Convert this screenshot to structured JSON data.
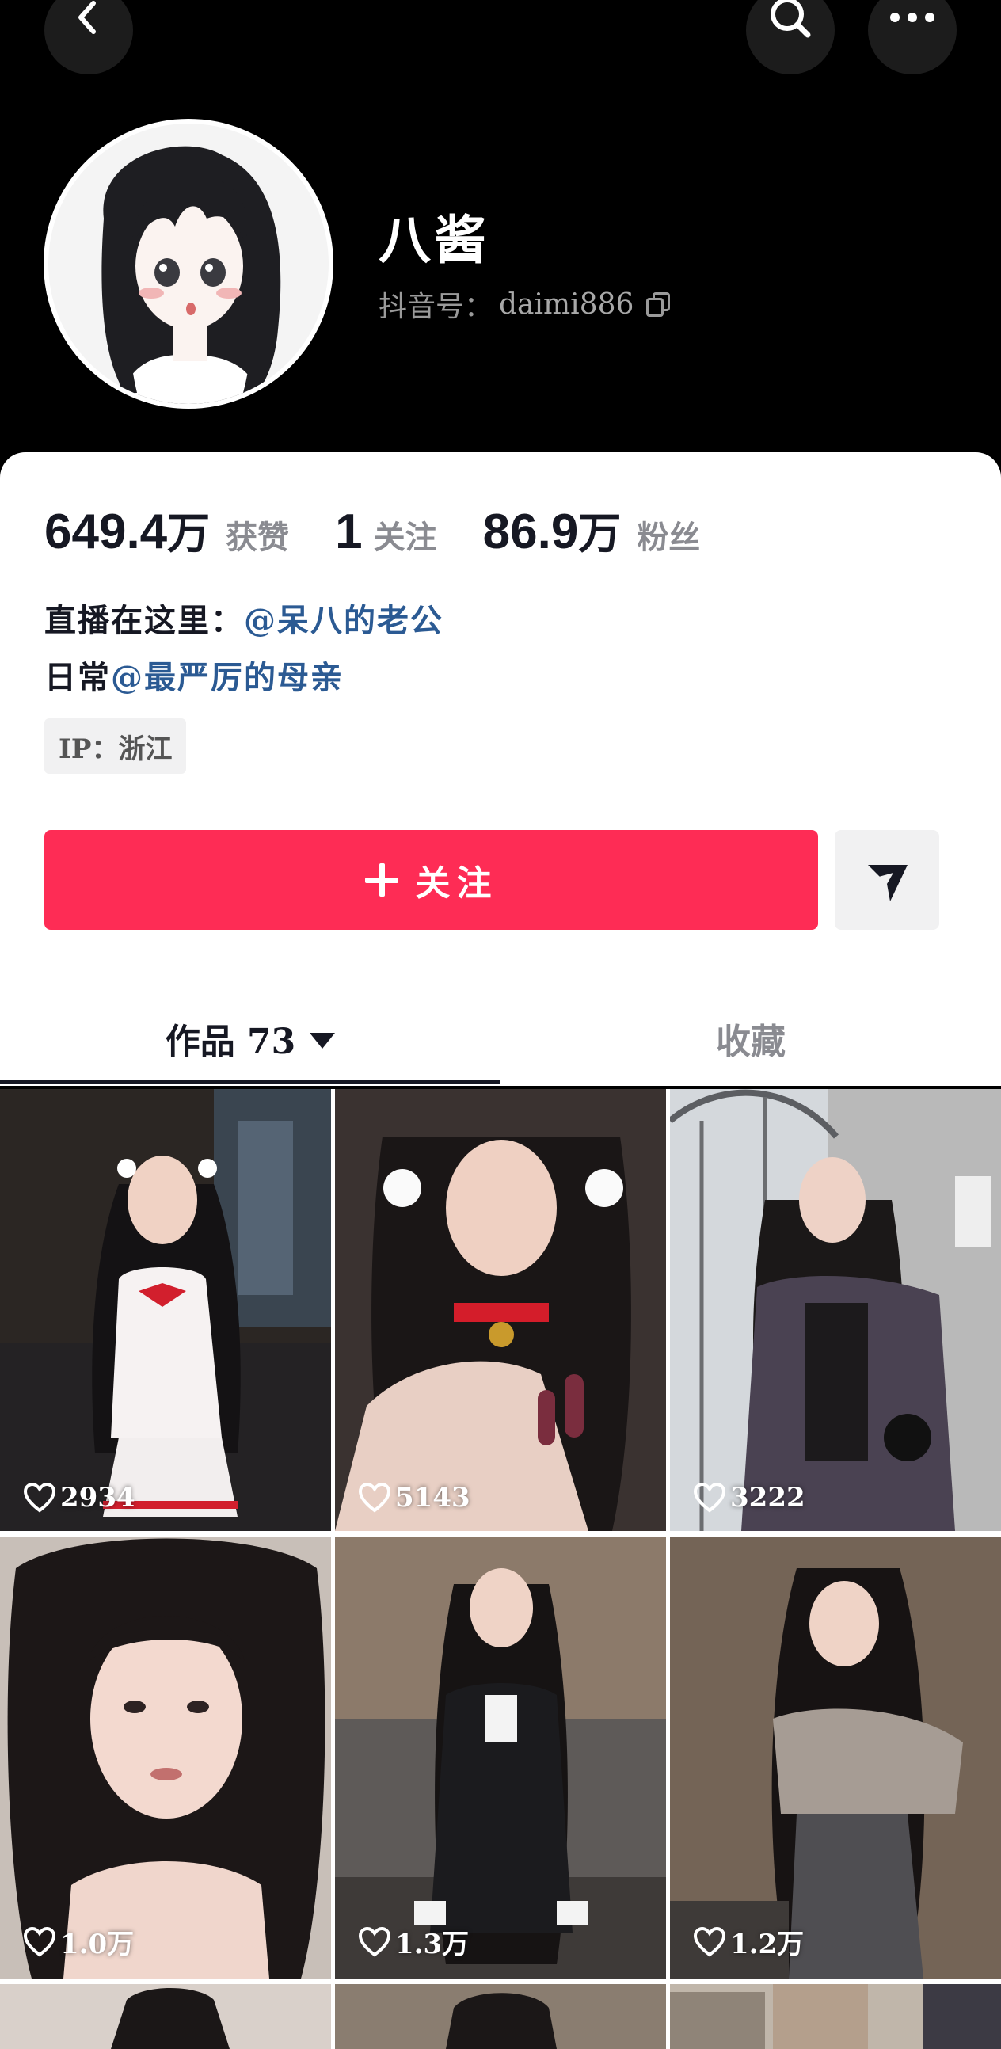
{
  "profile": {
    "name": "八酱",
    "handle_label": "抖音号：",
    "handle_value": "daimi886"
  },
  "stats": {
    "likes_num": "649.4",
    "likes_unit": "万",
    "likes_label": "获赞",
    "following_num": "1",
    "following_label": "关注",
    "followers_num": "86.9",
    "followers_unit": "万",
    "followers_label": "粉丝"
  },
  "bio": {
    "line1_prefix": "直播在这里：",
    "line1_mention": "@呆八的老公",
    "line2_prefix": "日常",
    "line2_mention": "@最严厉的母亲"
  },
  "ip_tag": "IP：浙江",
  "actions": {
    "follow_label": "关注"
  },
  "tabs": {
    "works_label": "作品 73",
    "favorites_label": "收藏"
  },
  "videos": [
    {
      "likes": "2934"
    },
    {
      "likes": "5143"
    },
    {
      "likes": "3222"
    },
    {
      "likes": "1.0万"
    },
    {
      "likes": "1.3万"
    },
    {
      "likes": "1.2万"
    }
  ],
  "colors": {
    "follow_button": "#fe2c55",
    "mention_link": "#2b5a93",
    "header_bg": "#000000"
  },
  "icons": {
    "back": "back-chevron-icon",
    "search": "search-icon",
    "more": "more-dots-icon",
    "copy": "copy-icon",
    "share": "send-share-icon",
    "heart": "heart-outline-icon"
  }
}
